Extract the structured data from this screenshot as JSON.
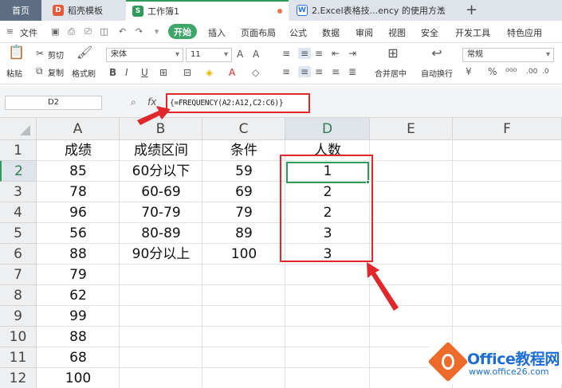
{
  "tabs": {
    "home": "首页",
    "daoke": "稻壳模板",
    "workbook": "工作簿1",
    "doc": "2.Excel表格技...ency 的使用方法"
  },
  "menu": {
    "file": "文件",
    "start": "开始",
    "insert": "插入",
    "layout": "页面布局",
    "formula": "公式",
    "data": "数据",
    "review": "审阅",
    "view": "视图",
    "security": "安全",
    "dev": "开发工具",
    "special": "特色应用"
  },
  "ribbon": {
    "paste": "粘贴",
    "cut": "剪切",
    "copy": "复制",
    "format_painter": "格式刷",
    "font_name": "宋体",
    "font_size": "11",
    "merge_center": "合并居中",
    "wrap_text": "自动换行",
    "number_format": "常规"
  },
  "formula_bar": {
    "name_box": "D2",
    "fx": "fx",
    "formula": "{=FREQUENCY(A2:A12,C2:C6)}"
  },
  "columns": [
    "A",
    "B",
    "C",
    "D",
    "E",
    "F"
  ],
  "rows": [
    "1",
    "2",
    "3",
    "4",
    "5",
    "6",
    "7",
    "8",
    "9",
    "10",
    "11",
    "12"
  ],
  "cells": {
    "A": [
      "成绩",
      "85",
      "78",
      "96",
      "56",
      "88",
      "79",
      "62",
      "99",
      "88",
      "68",
      "100"
    ],
    "B": [
      "成绩区间",
      "60分以下",
      "60-69",
      "70-79",
      "80-89",
      "90分以上",
      "",
      "",
      "",
      "",
      "",
      ""
    ],
    "C": [
      "条件",
      "59",
      "69",
      "79",
      "89",
      "100",
      "",
      "",
      "",
      "",
      "",
      ""
    ],
    "D": [
      "人数",
      "1",
      "2",
      "2",
      "3",
      "3",
      "",
      "",
      "",
      "",
      "",
      ""
    ]
  },
  "logo": {
    "name": "Office教程网",
    "url": "www.office26.com"
  },
  "colors": {
    "accent_green": "#2e9b5c",
    "annotation_red": "#e0272b"
  }
}
